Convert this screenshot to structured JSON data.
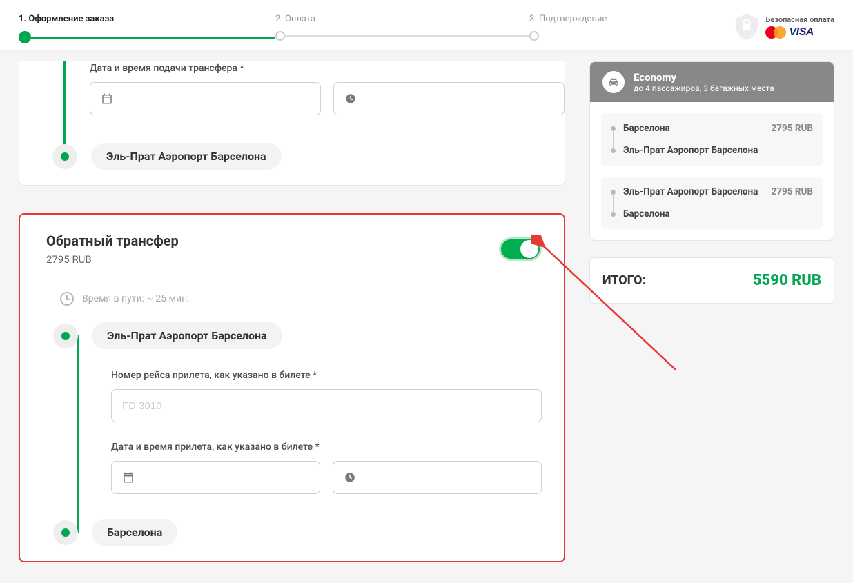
{
  "progress": {
    "steps": [
      {
        "label": "1. Оформление заказа",
        "active": true
      },
      {
        "label": "2. Оплата",
        "active": false
      },
      {
        "label": "3. Подтверждение",
        "active": false
      }
    ],
    "secure_label": "Безопасная оплата",
    "visa": "VISA"
  },
  "first_block": {
    "datetime_label": "Дата и время подачи трансфера *",
    "destination": "Эль-Прат Аэропорт Барселона"
  },
  "return_block": {
    "title": "Обратный трансфер",
    "price": "2795 RUB",
    "toggle_on": true,
    "travel_time": "Время в пути: ~ 25 мин.",
    "origin": "Эль-Прат Аэропорт Барселона",
    "flight_label": "Номер рейса прилета, как указано в билете *",
    "flight_placeholder": "FD 3010",
    "datetime_label": "Дата и время прилета, как указано в билете *",
    "destination": "Барселона"
  },
  "sidebar": {
    "class_title": "Economy",
    "class_sub": "до 4 пассажиров, 3 багажных места",
    "trips": [
      {
        "from": "Барселона",
        "to": "Эль-Прат Аэропорт Барселона",
        "price": "2795 RUB"
      },
      {
        "from": "Эль-Прат Аэропорт Барселона",
        "to": "Барселона",
        "price": "2795 RUB"
      }
    ],
    "total_label": "ИТОГО:",
    "total_value": "5590 RUB"
  }
}
